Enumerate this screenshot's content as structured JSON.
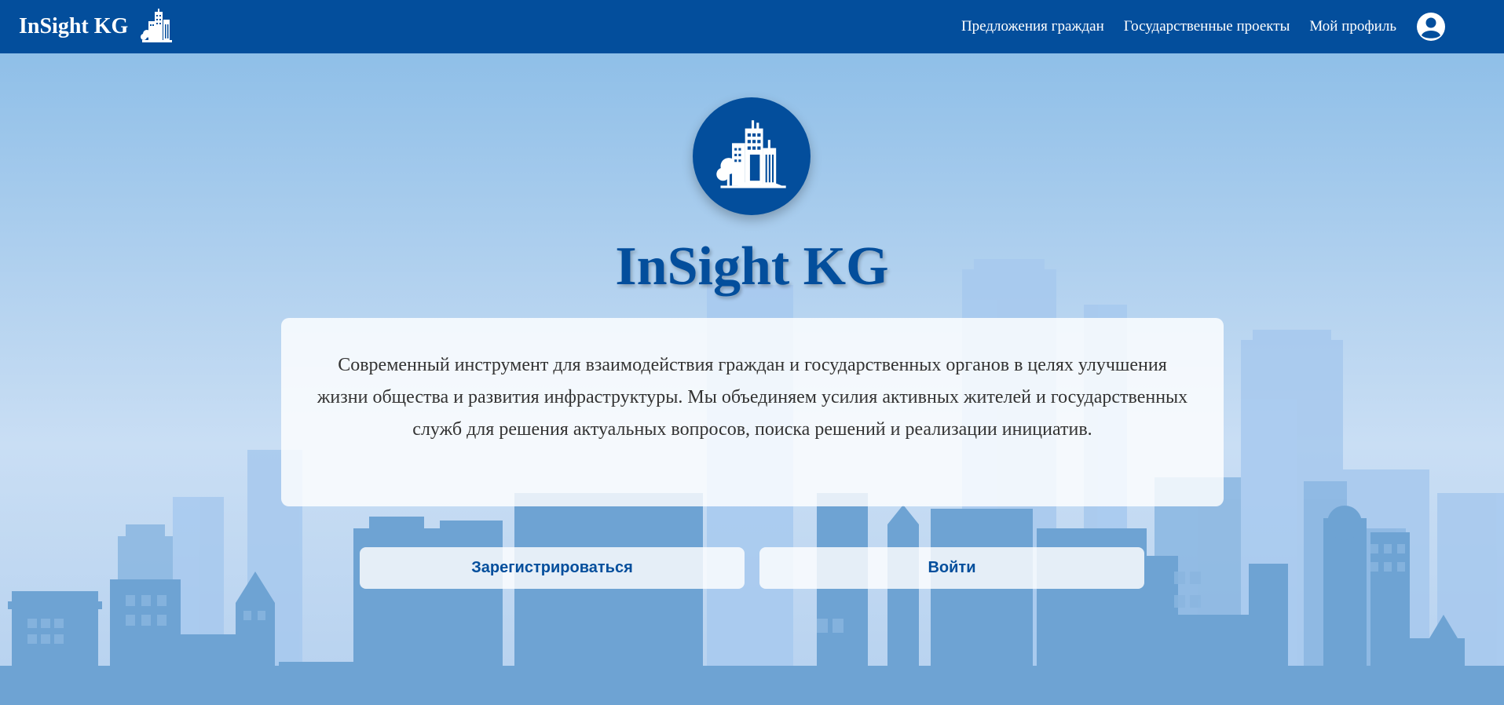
{
  "navbar": {
    "brand": "InSight KG",
    "links": [
      "Предложения граждан",
      "Государственные проекты",
      "Мой профиль"
    ],
    "profile_icon": "user-circle-icon"
  },
  "hero": {
    "title": "InSight KG",
    "logo_icon": "city-buildings-icon",
    "description": "Современный инструмент для взаимодействия граждан и государственных органов в целях улучшения жизни общества и развития инфраструктуры. Мы объединяем усилия активных жителей и государственных служб для решения актуальных вопросов, поиска решений и реализации инициатив.",
    "register_label": "Зарегистрироваться",
    "login_label": "Войти"
  },
  "colors": {
    "primary": "#034e9c",
    "sky": "#a9c9ea",
    "buildings": "#6ea3d3"
  }
}
